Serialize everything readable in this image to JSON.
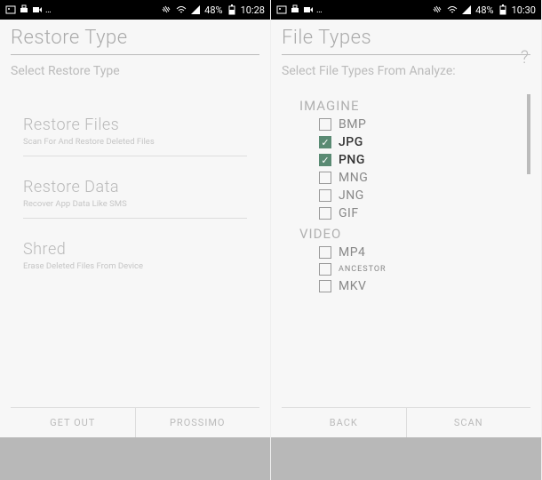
{
  "left": {
    "status": {
      "battery": "48%",
      "time": "10:28"
    },
    "title": "Restore Type",
    "subtitle": "Select Restore Type",
    "options": [
      {
        "title": "Restore Files",
        "sub": "Scan For And Restore Deleted Files"
      },
      {
        "title": "Restore Data",
        "sub": "Recover App Data Like SMS"
      },
      {
        "title": "Shred",
        "sub": "Erase Deleted Files From Device"
      }
    ],
    "footer": {
      "left": "GET OUT",
      "right": "PROSSIMO"
    }
  },
  "right": {
    "status": {
      "battery": "48%",
      "time": "10:30"
    },
    "title": "File Types",
    "subtitle": "Select File Types From Analyze:",
    "help": "?",
    "groups": [
      {
        "label": "IMAGINE",
        "items": [
          {
            "label": "BMP",
            "checked": false
          },
          {
            "label": "JPG",
            "checked": true
          },
          {
            "label": "PNG",
            "checked": true
          },
          {
            "label": "MNG",
            "checked": false
          },
          {
            "label": "JNG",
            "checked": false
          },
          {
            "label": "GIF",
            "checked": false
          }
        ]
      },
      {
        "label": "VIDEO",
        "items": [
          {
            "label": "MP4",
            "checked": false
          },
          {
            "label": "ANCESTOR",
            "checked": false,
            "small": true
          },
          {
            "label": "MKV",
            "checked": false
          }
        ]
      }
    ],
    "footer": {
      "left": "BACK",
      "right": "SCAN"
    }
  },
  "icons": {
    "wifi": "wifi",
    "signal": "signal",
    "vibrate": "vibrate"
  }
}
